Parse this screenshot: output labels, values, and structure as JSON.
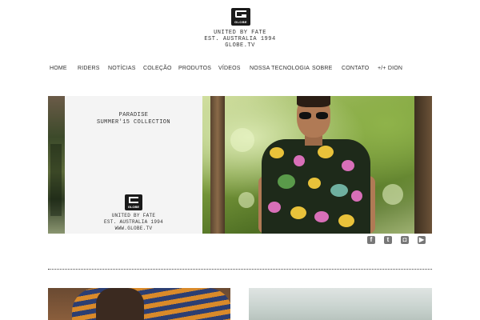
{
  "brand": {
    "logo_text": "GLOBE",
    "tagline": [
      "UNITED BY FATE",
      "EST. AUSTRALIA 1994",
      "GLOBE.TV"
    ]
  },
  "nav": {
    "items": [
      "HOME",
      "RIDERS",
      "NOTÍCIAS",
      "COLEÇÃO",
      "PRODUTOS",
      "VÍDEOS",
      "NOSSA TECNOLOGIA",
      "SOBRE",
      "CONTATO",
      "+/+ DION"
    ]
  },
  "banner": {
    "title_line1": "PARADISE",
    "title_line2": "SUMMER'15 COLLECTION",
    "logo_text": "GLOBE",
    "tagline": [
      "UNITED BY FATE",
      "EST. AUSTRALIA 1994",
      "WWW.GLOBE.TV"
    ]
  },
  "social": [
    {
      "icon": "facebook-icon",
      "glyph": "f"
    },
    {
      "icon": "twitter-icon",
      "glyph": "t"
    },
    {
      "icon": "instagram-icon",
      "glyph": "◘"
    },
    {
      "icon": "youtube-icon",
      "glyph": "▶"
    }
  ],
  "colors": {
    "background": "#ffffff",
    "text": "#333333",
    "panel": "#f4f4f4",
    "social_icon": "#777777"
  }
}
